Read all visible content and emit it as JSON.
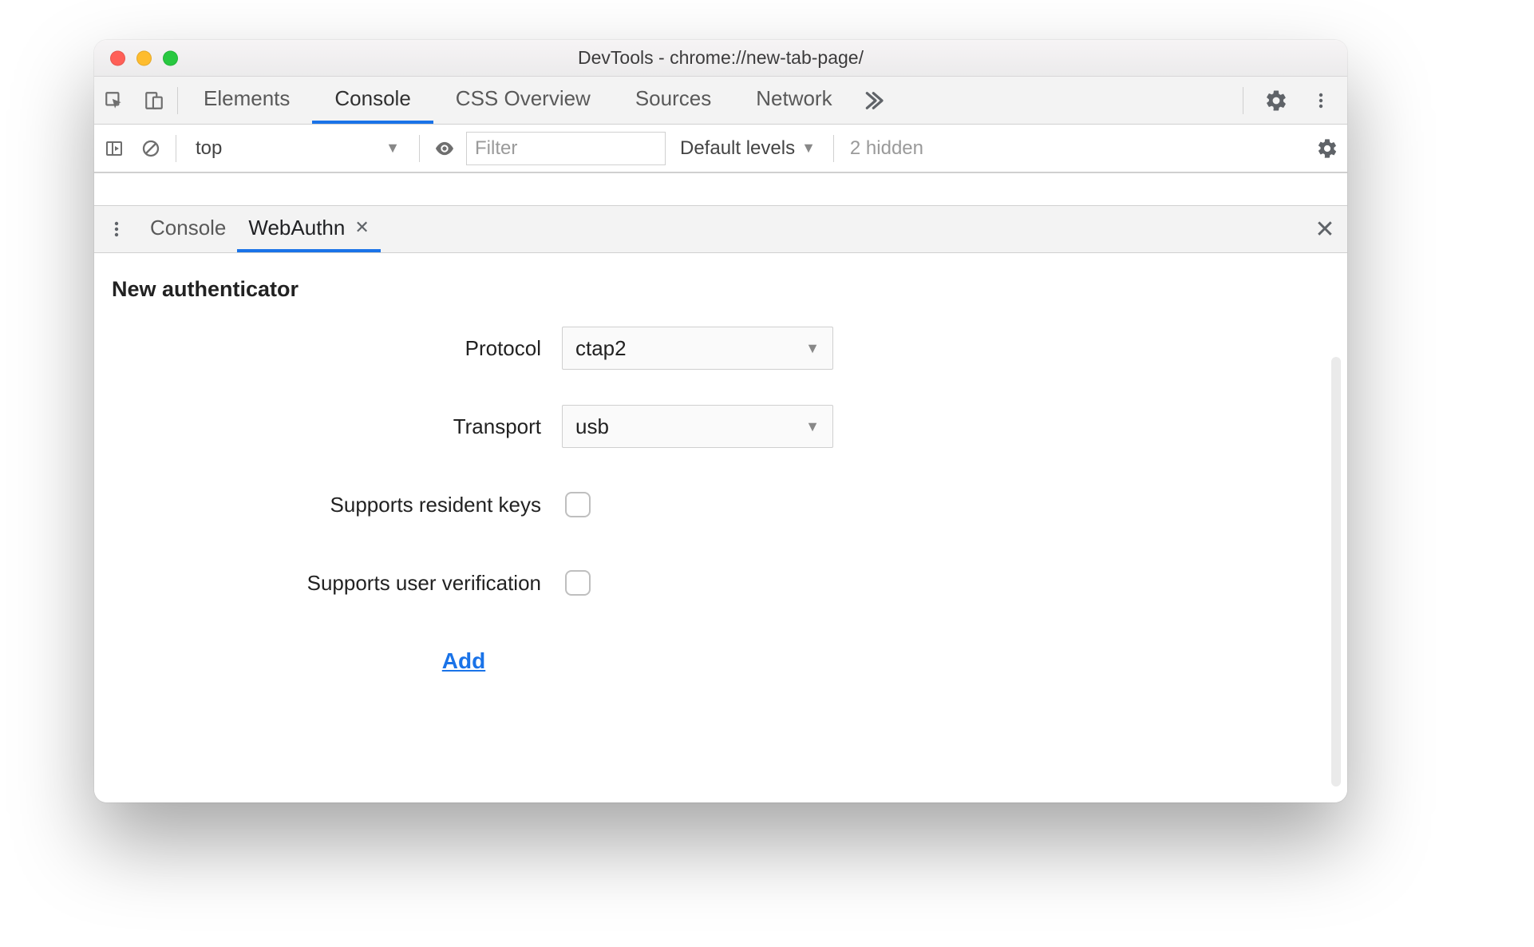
{
  "window": {
    "title": "DevTools - chrome://new-tab-page/"
  },
  "top_tabs": {
    "items": [
      "Elements",
      "Console",
      "CSS Overview",
      "Sources",
      "Network"
    ],
    "active_index": 1
  },
  "console_bar": {
    "context": "top",
    "filter_placeholder": "Filter",
    "levels_label": "Default levels",
    "hidden_label": "2 hidden"
  },
  "drawer": {
    "tabs": [
      "Console",
      "WebAuthn"
    ],
    "active_index": 1
  },
  "webauthn": {
    "section_title": "New authenticator",
    "labels": {
      "protocol": "Protocol",
      "transport": "Transport",
      "resident_keys": "Supports resident keys",
      "user_verification": "Supports user verification"
    },
    "values": {
      "protocol": "ctap2",
      "transport": "usb",
      "resident_keys": false,
      "user_verification": false
    },
    "add_label": "Add"
  }
}
